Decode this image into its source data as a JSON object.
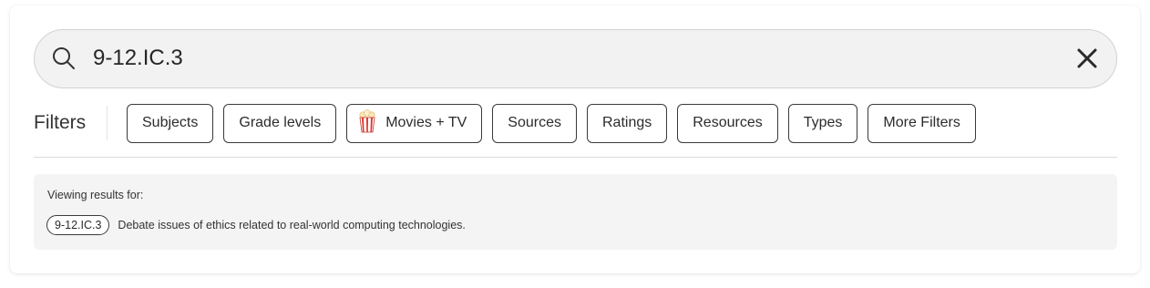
{
  "search": {
    "value": "9-12.IC.3",
    "icon": "search-icon",
    "clear_icon": "close-icon"
  },
  "filters": {
    "label": "Filters",
    "chips": [
      {
        "label": "Subjects"
      },
      {
        "label": "Grade levels"
      },
      {
        "label": "Movies + TV",
        "icon": "popcorn-icon"
      },
      {
        "label": "Sources"
      },
      {
        "label": "Ratings"
      },
      {
        "label": "Resources"
      },
      {
        "label": "Types"
      },
      {
        "label": "More Filters"
      }
    ]
  },
  "results": {
    "heading": "Viewing results for:",
    "standard_code": "9-12.IC.3",
    "standard_description": "Debate issues of ethics related to real-world computing technologies."
  },
  "colors": {
    "search_bg": "#f2f2f2",
    "results_bg": "#f4f4f4",
    "chip_border": "#3a3a3a",
    "popcorn_red": "#e0342c"
  }
}
